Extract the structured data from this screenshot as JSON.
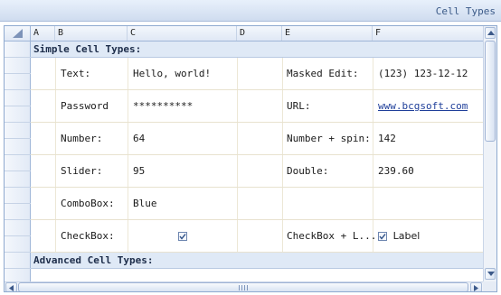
{
  "window": {
    "title": "Cell Types"
  },
  "columns": [
    "A",
    "B",
    "C",
    "D",
    "E",
    "F"
  ],
  "groups": {
    "simple": "Simple Cell Types:",
    "advanced": "Advanced Cell Types:"
  },
  "rows": [
    {
      "label_left": "Text:",
      "value_left": "Hello, world!",
      "label_right": "Masked Edit:",
      "value_right": "(123) 123-12-12"
    },
    {
      "label_left": "Password",
      "value_left": "**********",
      "label_right": "URL:",
      "value_right": "www.bcgsoft.com"
    },
    {
      "label_left": "Number:",
      "value_left": "64",
      "label_right": "Number + spin:",
      "value_right": "142"
    },
    {
      "label_left": "Slider:",
      "value_left": "95",
      "label_right": "Double:",
      "value_right": "239.60"
    },
    {
      "label_left": "ComboBox:",
      "value_left": "Blue",
      "label_right": "",
      "value_right": ""
    },
    {
      "label_left": "CheckBox:",
      "value_left": "",
      "label_right": "CheckBox + L...",
      "value_right": "Label"
    }
  ],
  "checkboxes": {
    "checkbox_checked": true,
    "checkbox_label_checked": true
  },
  "colors": {
    "header_bg": "#dfe8f5",
    "group_bg": "#dfe9f6",
    "link": "#1f3f9a",
    "grid_line": "#ece7d6"
  }
}
